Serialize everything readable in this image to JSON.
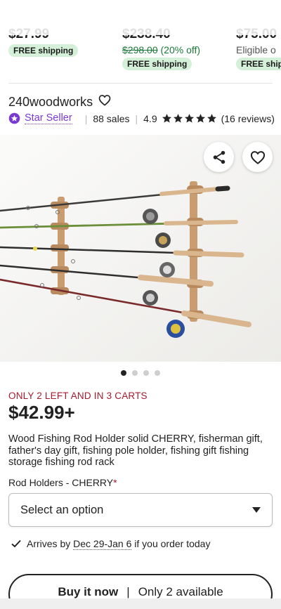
{
  "recommended": [
    {
      "price": "$27.99",
      "badge": "FREE shipping"
    },
    {
      "price": "$238.40",
      "original_price": "$298.00",
      "discount": "(20% off)",
      "badge": "FREE shipping"
    },
    {
      "price": "$75.00",
      "eligible": "Eligible o",
      "badge": "FREE shipp"
    }
  ],
  "shop": {
    "name": "240woodworks",
    "star_seller": "Star Seller",
    "sales": "88 sales",
    "rating": "4.9",
    "rating_stars": 5,
    "reviews": "(16 reviews)"
  },
  "gallery": {
    "image_count": 4,
    "active_index": 0
  },
  "listing": {
    "stock_note": "ONLY 2 LEFT AND IN 3 CARTS",
    "price": "$42.99+",
    "title": "Wood Fishing Rod Holder solid CHERRY, fisherman gift, father's day gift, fishing pole holder, fishing gift fishing storage fishing rod rack",
    "variant_label": "Rod Holders - CHERRY",
    "variant_required_mark": "*",
    "select_placeholder": "Select an option",
    "arrives_prefix": "Arrives by",
    "arrives_dates": "Dec 29-Jan 6",
    "arrives_suffix": "if you order today",
    "buy_label": "Buy it now",
    "buy_separator": "|",
    "buy_availability": "Only 2 available"
  },
  "colors": {
    "accent_purple": "#7a3ad1",
    "alert_red": "#a61a2e",
    "badge_green": "#d4f0d8",
    "discount_green": "#1a7a3a"
  }
}
